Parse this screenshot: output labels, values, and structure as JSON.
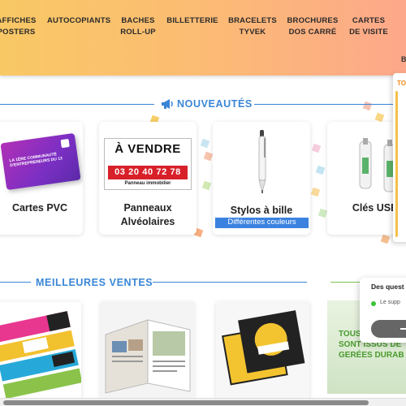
{
  "nav": {
    "items": [
      {
        "line1": "AFFICHES",
        "line2": "POSTERS"
      },
      {
        "line1": "AUTOCOPIANTS",
        "line2": ""
      },
      {
        "line1": "BACHES",
        "line2": "ROLL-UP"
      },
      {
        "line1": "BILLETTERIE",
        "line2": ""
      },
      {
        "line1": "BRACELETS",
        "line2": "TYVEK"
      },
      {
        "line1": "BROCHURES",
        "line2": "DOS CARRÉ"
      },
      {
        "line1": "CARTES",
        "line2": "DE VISITE"
      }
    ],
    "overflow_letter": "B"
  },
  "nouveautes": {
    "title": "NOUVEAUTÉS",
    "icon": "megaphone-icon",
    "cards": [
      {
        "line1": "Cartes PVC",
        "line2": ""
      },
      {
        "line1": "Panneaux",
        "line2": "Alvéolaires"
      },
      {
        "line1": "Stylos à bille",
        "line2": "",
        "badge": "Différentes couleurs"
      },
      {
        "line1": "Clés USB",
        "line2": ""
      }
    ],
    "pvc_image_text": "LA 1ÈRE COMMUNAUTÉ D'ENTREPRENEURS DU 13",
    "vendre_image": {
      "title": "À VENDRE",
      "phone": "03 20 40 72 78",
      "subtitle": "Panneau immobilier"
    }
  },
  "meilleures_ventes": {
    "title": "MEILLEURES VENTES"
  },
  "promo_popup": {
    "label": "TO"
  },
  "chat": {
    "question": "Des quest",
    "status": "Le supp"
  },
  "eco_banner": {
    "lines": [
      "TOUS",
      "SONT ISSUS DE",
      "GERÉES DURAB"
    ]
  },
  "colors": {
    "accent_blue": "#3a86d6",
    "badge_blue": "#3b82e0",
    "eco_green": "#4a9a2e",
    "promo_orange": "#f28a1c"
  }
}
